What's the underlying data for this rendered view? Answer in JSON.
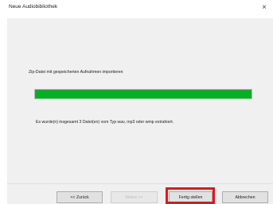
{
  "window": {
    "title": "Neue Audiobibliothek",
    "close_glyph": "×"
  },
  "content": {
    "description": "Zip-Datei mit gespeicherten Aufnahmen importieren",
    "progress_percent": 100,
    "progress_color": "#06b025",
    "status_text": "Es wurde(n) insgesamt 3 Datei(en) vom Typ wav, mp3 oder wmp extrahiert."
  },
  "buttons": {
    "back": "<< Zurück",
    "next": "Weiter >>",
    "finish": "Fertig stellen",
    "cancel": "Abbrechen"
  },
  "highlight": {
    "color": "#ee1111",
    "target": "finish-button"
  }
}
